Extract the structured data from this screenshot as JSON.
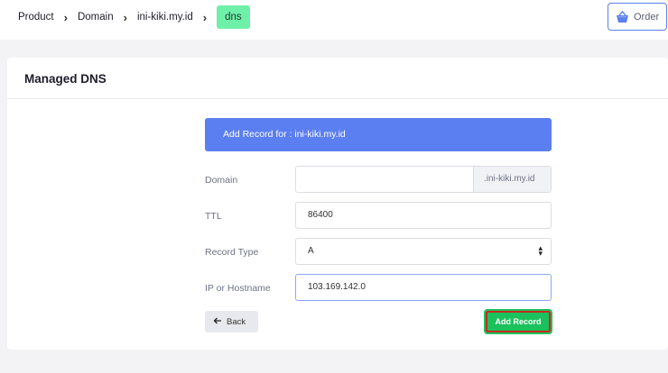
{
  "breadcrumb": {
    "items": [
      "Product",
      "Domain",
      "ini-kiki.my.id"
    ],
    "active": "dns",
    "separator": "›"
  },
  "header": {
    "order_label": "Order"
  },
  "card": {
    "title": "Managed DNS",
    "banner": "Add Record for : ini-kiki.my.id"
  },
  "form": {
    "domain_label": "Domain",
    "domain_value": "",
    "domain_suffix": ".ini-kiki.my.id",
    "ttl_label": "TTL",
    "ttl_value": "86400",
    "record_type_label": "Record Type",
    "record_type_value": "A",
    "ip_label": "IP or Hostname",
    "ip_value": "103.169.142.0",
    "back_label": "Back",
    "add_label": "Add Record"
  },
  "colors": {
    "accent": "#5b7ff0",
    "active_crumb": "#6ff0a8",
    "add_button": "#1bc15d",
    "add_button_border": "#c52a1f"
  }
}
